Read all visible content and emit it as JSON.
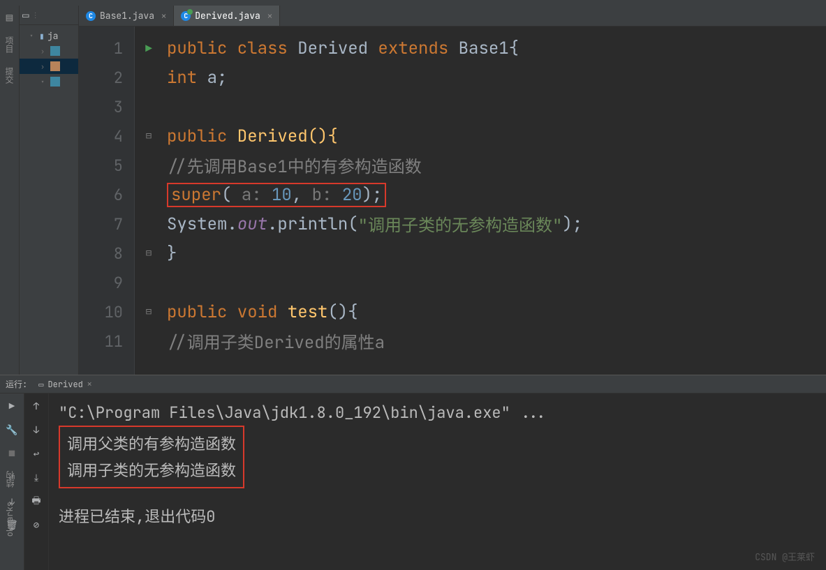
{
  "tabs": [
    {
      "label": "Base1.java",
      "active": false
    },
    {
      "label": "Derived.java",
      "active": true
    }
  ],
  "left_rail": {
    "item1": "项目",
    "item2": "提交"
  },
  "project_tree": {
    "root_label": "ja",
    "nodes": [
      "",
      "",
      ""
    ]
  },
  "code": {
    "lines": [
      "1",
      "2",
      "3",
      "4",
      "5",
      "6",
      "7",
      "8",
      "9",
      "10",
      "11"
    ],
    "l1_public": "public",
    "l1_class": " class ",
    "l1_derived": "Derived",
    "l1_extends": " extends ",
    "l1_base": "Base1{",
    "l2_int": "int",
    "l2_a": " a;",
    "l4_public": "public",
    "l4_ctor": " Derived(){",
    "l5_comment": "//先调用Base1中的有参构造函数",
    "l6_super": "super",
    "l6_paren_open": "( ",
    "l6_a_hint": "a: ",
    "l6_val1": "10",
    "l6_comma": ", ",
    "l6_b_hint": "b: ",
    "l6_val2": "20",
    "l6_paren_close": ");",
    "l7_system": "System.",
    "l7_out": "out",
    "l7_println": ".println(",
    "l7_str": "\"调用子类的无参构造函数\"",
    "l7_end": ");",
    "l8": "}",
    "l10_public": "public",
    "l10_void": " void ",
    "l10_test": "test",
    "l10_end": "(){",
    "l11_comment": "//调用子类Derived的属性a"
  },
  "run": {
    "label": "运行:",
    "tab_name": "Derived",
    "command": "\"C:\\Program Files\\Java\\jdk1.8.0_192\\bin\\java.exe\" ...",
    "output1": "调用父类的有参构造函数",
    "output2": "调用子类的无参构造函数",
    "exit": "进程已结束,退出代码0"
  },
  "bottom_rail": {
    "item1": "结构",
    "item2": "okmarks"
  },
  "watermark": "CSDN @王莱虾"
}
